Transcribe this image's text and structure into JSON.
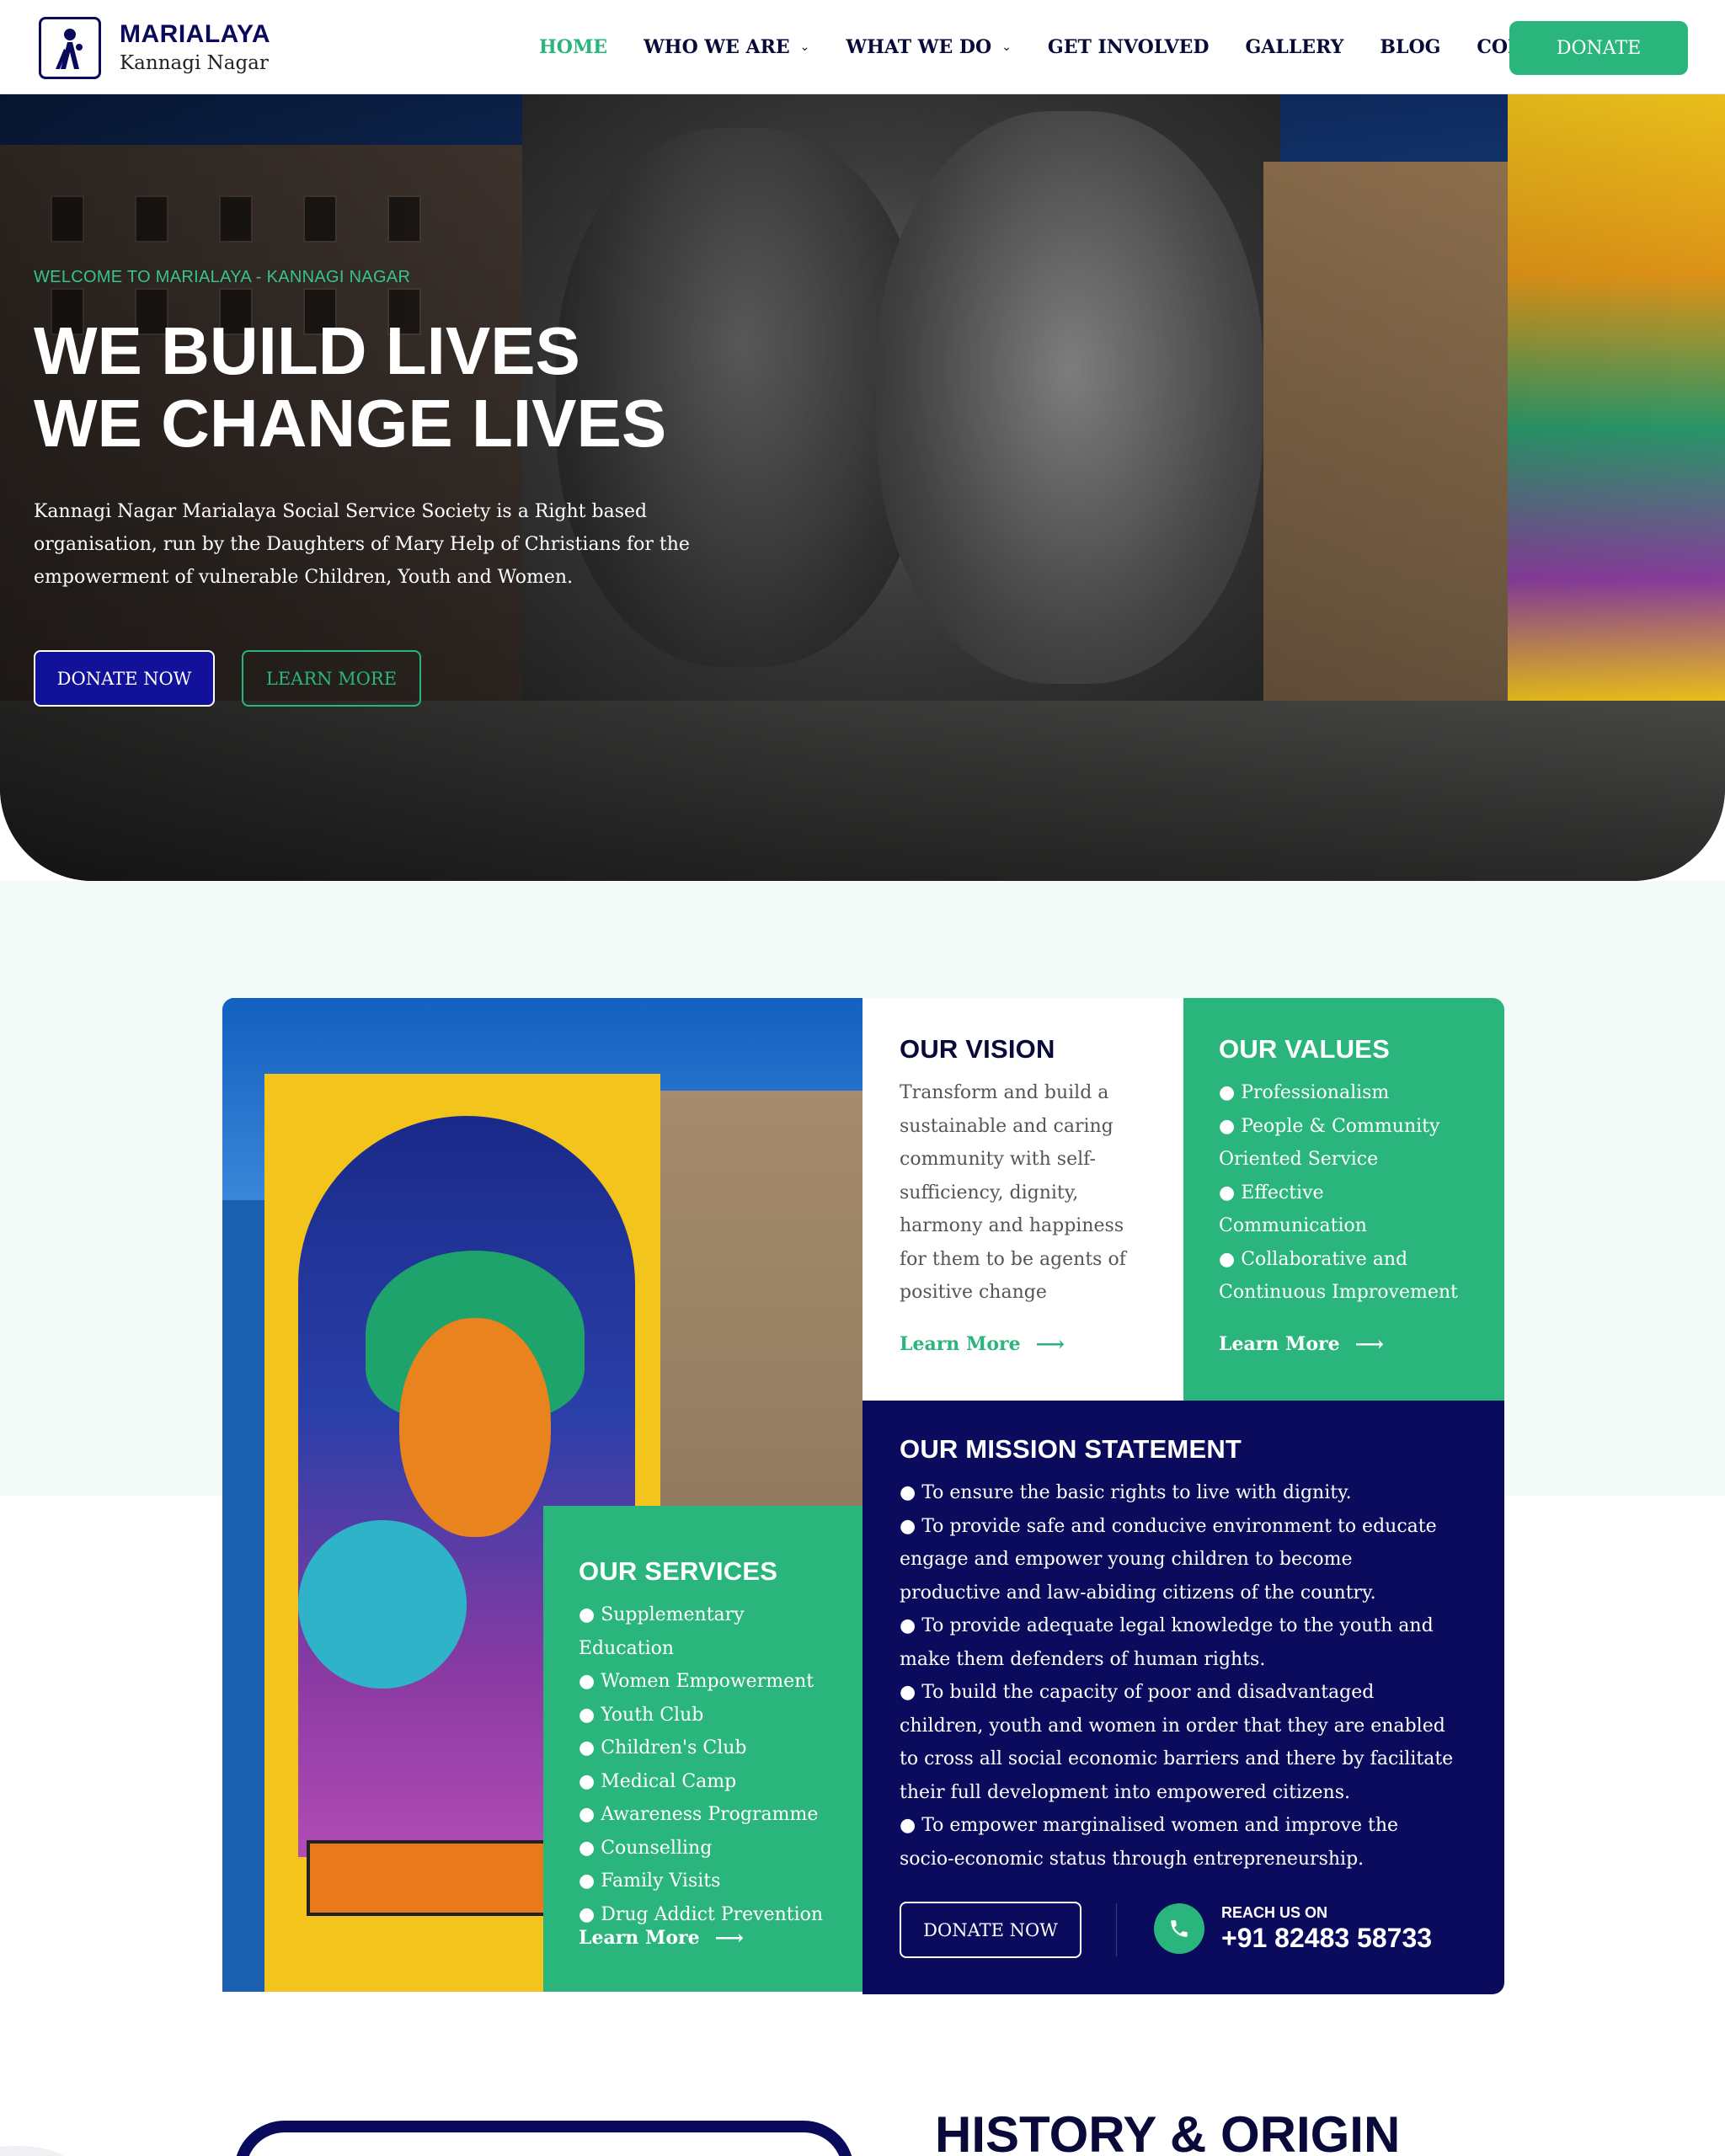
{
  "header": {
    "brand_name": "MARIALAYA",
    "brand_sub": "Kannagi Nagar",
    "nav": [
      {
        "label": "HOME",
        "active": true,
        "dropdown": false
      },
      {
        "label": "WHO WE ARE",
        "active": false,
        "dropdown": true
      },
      {
        "label": "WHAT WE DO",
        "active": false,
        "dropdown": true
      },
      {
        "label": "GET INVOLVED",
        "active": false,
        "dropdown": false
      },
      {
        "label": "GALLERY",
        "active": false,
        "dropdown": false
      },
      {
        "label": "BLOG",
        "active": false,
        "dropdown": false
      },
      {
        "label": "CONTACT",
        "active": false,
        "dropdown": false
      }
    ],
    "donate_label": "DONATE"
  },
  "hero": {
    "eyebrow": "WELCOME TO MARIALAYA - KANNAGI NAGAR",
    "title_line1": "WE BUILD LIVES",
    "title_line2": "WE CHANGE LIVES",
    "description": "Kannagi Nagar Marialaya Social Service Society is a Right based organisation, run by the Daughters of Mary Help of Christians for the empowerment of vulnerable Children, Youth and Women.",
    "donate_label": "DONATE NOW",
    "learn_label": "LEARN MORE"
  },
  "vision": {
    "title": "OUR VISION",
    "text": "Transform and build a sustainable and caring community with self-sufficiency, dignity, harmony and happiness for them to be agents of positive change",
    "link": "Learn More"
  },
  "values": {
    "title": "OUR VALUES",
    "items": [
      "● Professionalism",
      "● People & Community Oriented Service",
      "● Effective Communication",
      "● Collaborative and Continuous Improvement"
    ],
    "link": "Learn More"
  },
  "services": {
    "title": "OUR SERVICES",
    "items": [
      "● Supplementary Education",
      "● Women Empowerment",
      "● Youth Club",
      "● Children's Club",
      "● Medical Camp",
      "● Awareness Programme",
      "● Counselling",
      "● Family Visits",
      "● Drug Addict Prevention"
    ],
    "link": "Learn More"
  },
  "mission": {
    "title": "OUR MISSION STATEMENT",
    "items": [
      "● To ensure the basic rights to live with dignity.",
      "● To provide safe and conducive environment to educate engage and empower young children to become productive and law-abiding citizens of the country.",
      "● To provide adequate legal knowledge to the youth and make them defenders of human rights.",
      "● To build the capacity of poor and disadvantaged children, youth and women in order that they are enabled to cross all social economic barriers and there by facilitate their full development into empowered citizens.",
      "● To empower marginalised women and improve the socio-economic status through entrepreneurship."
    ],
    "donate_label": "DONATE NOW",
    "reach_label": "REACH US ON",
    "phone": "+91 82483 58733"
  },
  "history": {
    "title": "HISTORY & ORIGIN"
  },
  "colors": {
    "green": "#2ab57d",
    "navy": "#0b0b5e",
    "royal_blue": "#11119a",
    "band_bg": "#f3fbf9"
  },
  "icons": {
    "logo": "marialaya-logo-icon",
    "chevron": "chevron-down-icon",
    "arrow": "arrow-right-icon",
    "phone": "phone-icon"
  }
}
